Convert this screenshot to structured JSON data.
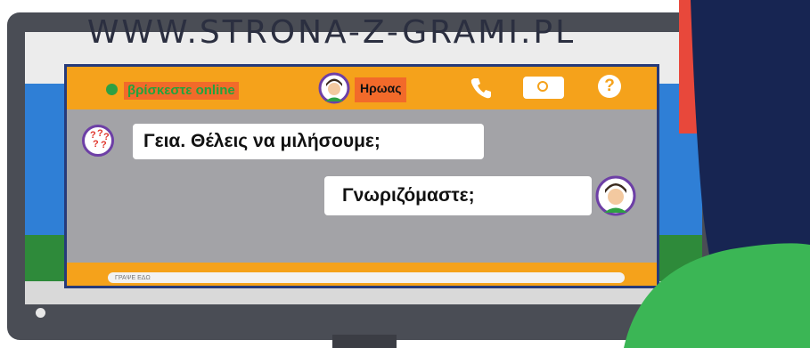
{
  "browser": {
    "url_text": "WWW.STRONA-Z-GRAMI.PL"
  },
  "chat": {
    "status_text": "βρίσκεστε online",
    "contact_name": "Ηρωας",
    "icons": [
      "phone-icon",
      "camera-icon",
      "help-icon"
    ],
    "messages": [
      {
        "from": "incoming",
        "text": "Γεια. Θέλεις να μιλήσουμε;"
      },
      {
        "from": "outgoing",
        "text": "Γνωριζόμαστε;"
      }
    ],
    "input_placeholder": "ΓΡΑΨΕ ΕΔΩ"
  },
  "colors": {
    "accent_orange": "#f5a21b",
    "highlight": "#f26a2a",
    "online_green": "#2ea043",
    "window_border": "#263a7a"
  }
}
